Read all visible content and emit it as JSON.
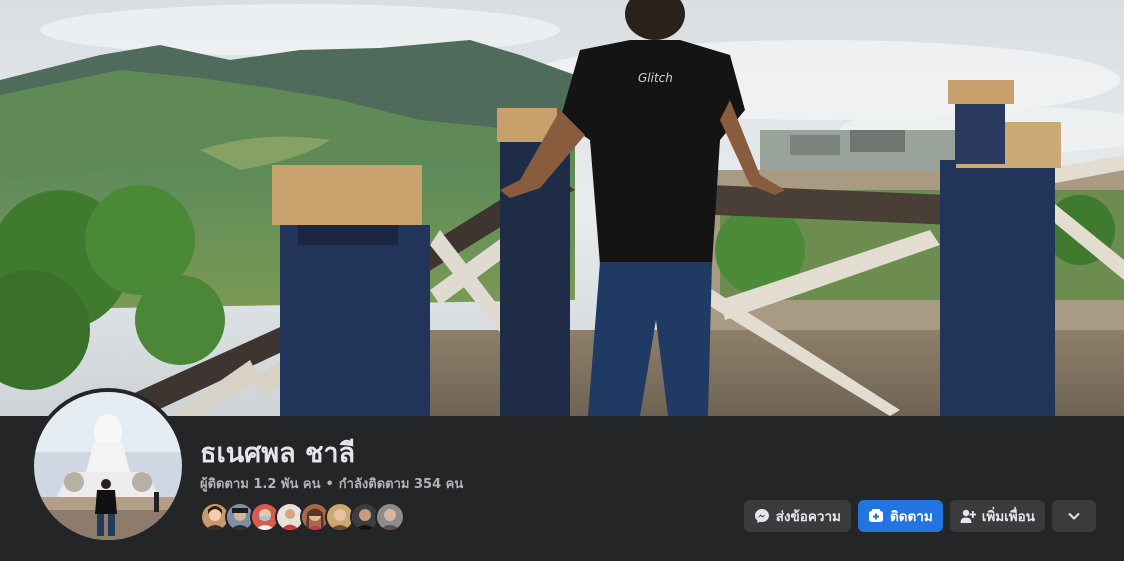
{
  "profile": {
    "name": "ธเนศพล ชาลี",
    "followers": "ผู้ติดตาม 1.2 พัน คน",
    "separator": "•",
    "following": "กำลังติดตาม 354 คน"
  },
  "actions": {
    "message": "ส่งข้อความ",
    "follow": "ติดตาม",
    "add_friend": "เพิ่มเพื่อน"
  },
  "icons": {
    "message": "messenger-icon",
    "follow": "follow-icon",
    "add_friend": "add-friend-icon",
    "more": "chevron-down-icon"
  },
  "colors": {
    "background": "#242526",
    "button_secondary": "#3a3b3c",
    "button_primary": "#2374e1",
    "text_primary": "#e4e6eb",
    "text_secondary": "#b0b3b8"
  },
  "friend_avatar_count": 8
}
